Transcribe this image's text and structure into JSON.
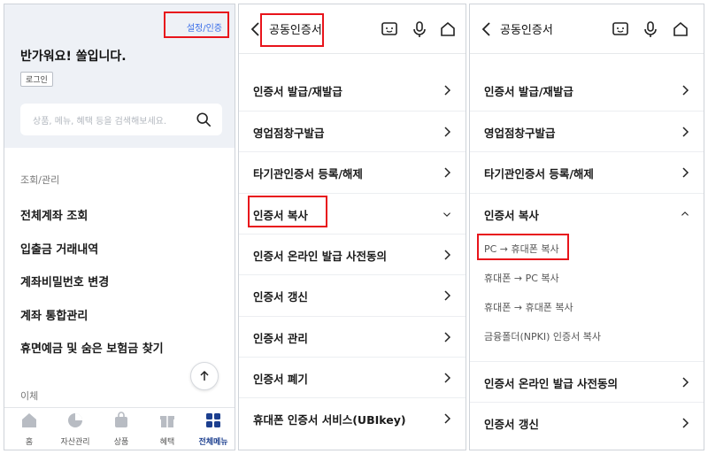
{
  "panel1": {
    "settings_badge": "설정/인증",
    "greeting": "반가워요! 쏠입니다.",
    "login_button": "로그인",
    "search_placeholder": "상품, 메뉴, 혜택 등을 검색해보세요.",
    "section_inquiry": "조회/관리",
    "menu": [
      "전체계좌 조회",
      "입출금 거래내역",
      "계좌비밀번호 변경",
      "계좌 통합관리",
      "휴면예금 및 숨은 보험금 찾기"
    ],
    "section_transfer": "이체",
    "tabs": [
      {
        "label": "홈",
        "icon": "home-icon"
      },
      {
        "label": "자산관리",
        "icon": "pie-chart-icon"
      },
      {
        "label": "상품",
        "icon": "shopping-bag-icon"
      },
      {
        "label": "혜택",
        "icon": "gift-icon"
      },
      {
        "label": "전체메뉴",
        "icon": "grid-menu-icon"
      }
    ],
    "accent_color": "#1c3f8f"
  },
  "panel2": {
    "title": "공동인증서",
    "header_icons": [
      "chat-icon",
      "mic-icon",
      "home-icon"
    ],
    "items": [
      "인증서 발급/재발급",
      "영업점창구발급",
      "타기관인증서 등록/해제",
      "인증서 복사",
      "인증서 온라인 발급 사전동의",
      "인증서 갱신",
      "인증서 관리",
      "인증서 폐기",
      "휴대폰 인증서 서비스(UBIkey)"
    ]
  },
  "panel3": {
    "title": "공동인증서",
    "header_icons": [
      "chat-icon",
      "mic-icon",
      "home-icon"
    ],
    "items_top": [
      "인증서 발급/재발급",
      "영업점창구발급",
      "타기관인증서 등록/해제",
      "인증서 복사"
    ],
    "copy_options": [
      "PC → 휴대폰 복사",
      "휴대폰 → PC 복사",
      "휴대폰 → 휴대폰 복사",
      "금융폴더(NPKI) 인증서 복사"
    ],
    "items_bottom": [
      "인증서 온라인 발급 사전동의",
      "인증서 갱신"
    ]
  },
  "highlight_color": "#e8141b"
}
